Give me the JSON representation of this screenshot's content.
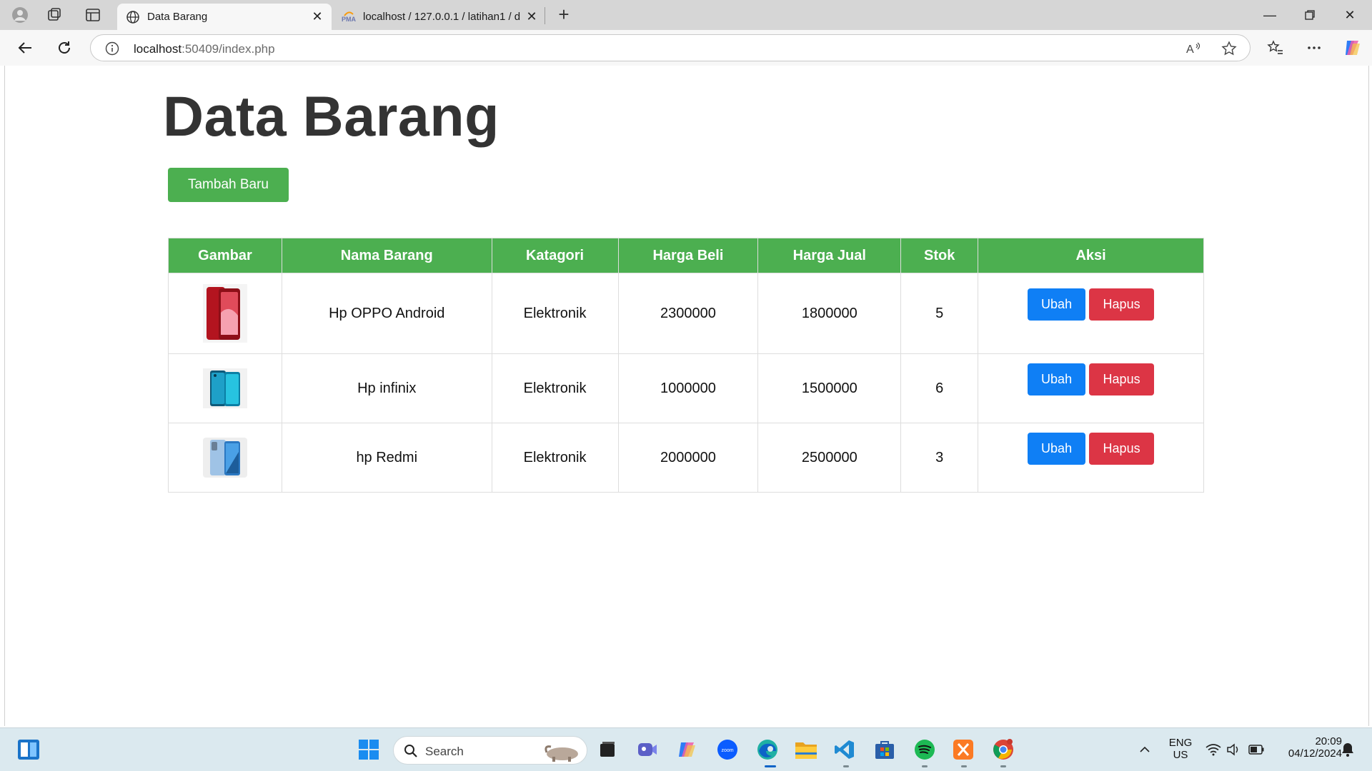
{
  "browser": {
    "tabs": [
      {
        "title": "Data Barang",
        "active": true
      },
      {
        "title": "localhost / 127.0.0.1 / latihan1 / d",
        "active": false
      }
    ],
    "url_host": "localhost",
    "url_rest": ":50409/index.php"
  },
  "page": {
    "title": "Data Barang",
    "add_button": "Tambah Baru",
    "table": {
      "headers": [
        "Gambar",
        "Nama Barang",
        "Katagori",
        "Harga Beli",
        "Harga Jual",
        "Stok",
        "Aksi"
      ],
      "rows": [
        {
          "nama": "Hp OPPO Android",
          "kategori": "Elektronik",
          "harga_beli": "2300000",
          "harga_jual": "1800000",
          "stok": "5",
          "ubah": "Ubah",
          "hapus": "Hapus"
        },
        {
          "nama": "Hp infinix",
          "kategori": "Elektronik",
          "harga_beli": "1000000",
          "harga_jual": "1500000",
          "stok": "6",
          "ubah": "Ubah",
          "hapus": "Hapus"
        },
        {
          "nama": "hp Redmi",
          "kategori": "Elektronik",
          "harga_beli": "2000000",
          "harga_jual": "2500000",
          "stok": "3",
          "ubah": "Ubah",
          "hapus": "Hapus"
        }
      ]
    }
  },
  "taskbar": {
    "search_placeholder": "Search",
    "lang_1": "ENG",
    "lang_2": "US",
    "time": "20:09",
    "date": "04/12/2024"
  },
  "colors": {
    "accent_green": "#4caf50",
    "button_blue": "#0f7ff5",
    "button_red": "#dc3545"
  }
}
